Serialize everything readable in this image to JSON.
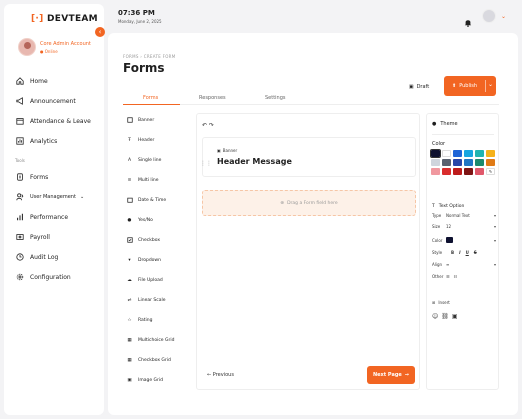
{
  "brand": {
    "name": "DEVTEAM",
    "bracket_left": "[",
    "bracket_right": "]",
    "accent": "#f26522"
  },
  "account": {
    "name": "Core Admin Account",
    "status": "● Online"
  },
  "sidebar": {
    "items": [
      {
        "label": "Home",
        "icon": "home-icon"
      },
      {
        "label": "Announcement",
        "icon": "megaphone-icon"
      },
      {
        "label": "Attendance & Leave",
        "icon": "calendar-icon"
      },
      {
        "label": "Analytics",
        "icon": "chart-icon"
      }
    ],
    "section": "Tools",
    "tools": [
      {
        "label": "Forms",
        "icon": "form-icon"
      },
      {
        "label": "User Management",
        "icon": "users-icon"
      },
      {
        "label": "Performance",
        "icon": "bar-chart-icon"
      },
      {
        "label": "Payroll",
        "icon": "wallet-icon"
      },
      {
        "label": "Audit Log",
        "icon": "clock-icon"
      },
      {
        "label": "Configuration",
        "icon": "gear-icon"
      }
    ]
  },
  "topbar": {
    "time": "07:36 PM",
    "date": "Monday, June 2, 2025"
  },
  "page": {
    "crumb": "FORMS  ›  CREATE FORM",
    "title": "Forms"
  },
  "actions": {
    "draft": "Draft",
    "publish": "Publish"
  },
  "tabs": [
    "Forms",
    "Responses",
    "Settings"
  ],
  "palette": [
    "Banner",
    "Header",
    "Single line",
    "Multi line",
    "Date & Time",
    "Yes/No",
    "Checkbox",
    "Dropdown",
    "File Upload",
    "Linear Scale",
    "Rating",
    "Multichoice Grid",
    "Checkbox Grid",
    "Image Grid"
  ],
  "canvas": {
    "undo": "↶ ↷",
    "banner_label": "Banner",
    "header_title": "Header Message",
    "drop_hint": "Drag a Form field here",
    "previous": "Previous",
    "next": "Next Page"
  },
  "theme": {
    "title": "Theme",
    "color_label": "Color",
    "swatches": [
      "#0e1130",
      "#ffffff",
      "#1e64d6",
      "#18a5e0",
      "#22b4b0",
      "#f6b21a",
      "#cfd5dd",
      "#5a6270",
      "#2846a8",
      "#1f76c4",
      "#1b8a6e",
      "#e07b16",
      "#f0989f",
      "#d92d2d",
      "#bd1c1c",
      "#7e1414",
      "#e0586a",
      "#ffffff"
    ],
    "text_option": "Text Option",
    "type_k": "Type",
    "type_v": "Normal Text",
    "size_k": "Size",
    "size_v": "12",
    "color_k": "Color",
    "style_k": "Style",
    "align_k": "Align",
    "other_k": "Other",
    "insert": "Insert"
  }
}
